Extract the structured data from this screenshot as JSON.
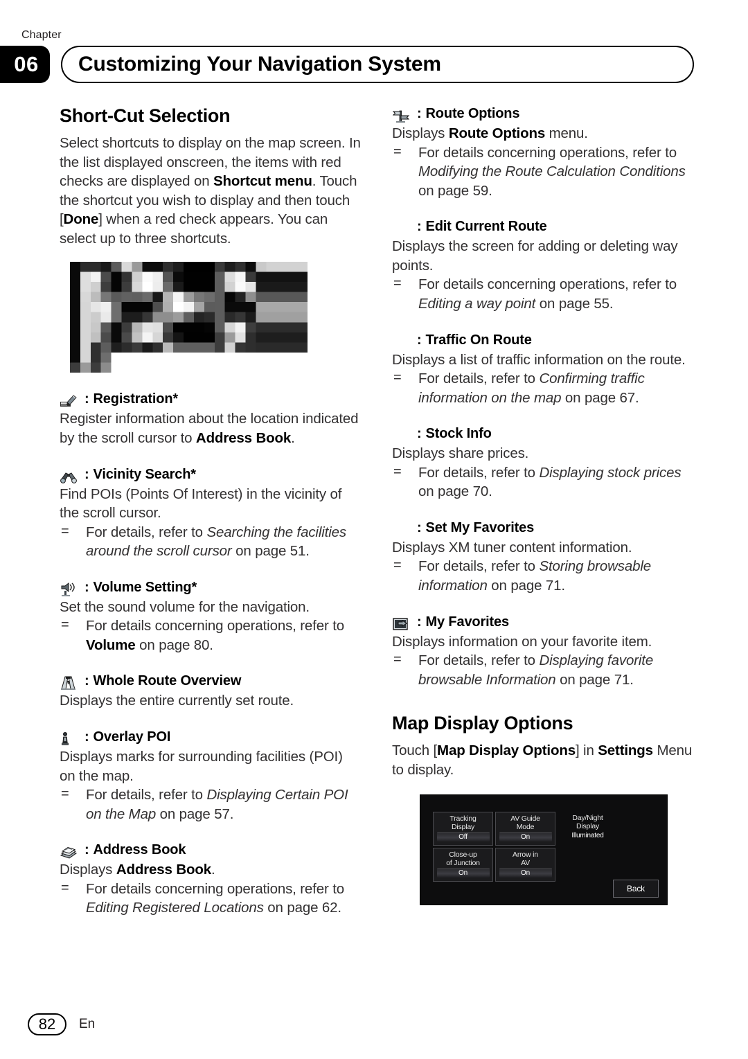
{
  "header": {
    "chapter_label": "Chapter",
    "chapter_number": "06",
    "title": "Customizing Your Navigation System"
  },
  "left_column": {
    "section_title": "Short-Cut Selection",
    "intro_runs": [
      {
        "t": "Select shortcuts to display on the map screen. In the list displayed onscreen, the items with red checks are displayed on ",
        "s": "n"
      },
      {
        "t": "Shortcut menu",
        "s": "b"
      },
      {
        "t": ". Touch the shortcut you wish to display and then touch [",
        "s": "n"
      },
      {
        "t": "Done",
        "s": "b"
      },
      {
        "t": "] when a red check appears. You can select up to three shortcuts.",
        "s": "n"
      }
    ],
    "screenshot_alt": "shortcut-selection-list-screenshot",
    "entries": [
      {
        "icon": "registration-pen-icon",
        "sep": ":",
        "title": "Registration*",
        "body_runs": [
          {
            "t": "Register information about the location indicated by the scroll cursor to ",
            "s": "n"
          },
          {
            "t": "Address Book",
            "s": "b"
          },
          {
            "t": ".",
            "s": "n"
          }
        ],
        "notes": []
      },
      {
        "icon": "binoculars-icon",
        "sep": ":",
        "title": "Vicinity Search*",
        "body_runs": [
          {
            "t": "Find POIs (Points Of Interest) in the vicinity of the scroll cursor.",
            "s": "n"
          }
        ],
        "notes": [
          {
            "mark": "=",
            "runs": [
              {
                "t": "For details, refer to ",
                "s": "n"
              },
              {
                "t": "Searching the facilities around the scroll cursor",
                "s": "i"
              },
              {
                "t": " on page 51.",
                "s": "n"
              }
            ]
          }
        ]
      },
      {
        "icon": "speaker-volume-icon",
        "sep": ":",
        "title": "Volume Setting*",
        "body_runs": [
          {
            "t": "Set the sound volume for the navigation.",
            "s": "n"
          }
        ],
        "notes": [
          {
            "mark": "=",
            "runs": [
              {
                "t": "For details concerning operations, refer to ",
                "s": "n"
              },
              {
                "t": "Volume",
                "s": "b"
              },
              {
                "t": " on page 80.",
                "s": "n"
              }
            ]
          }
        ]
      },
      {
        "icon": "whole-route-overview-icon",
        "sep": ":",
        "title": "Whole Route Overview",
        "body_runs": [
          {
            "t": "Displays the entire currently set route.",
            "s": "n"
          }
        ],
        "notes": []
      },
      {
        "icon": "overlay-poi-icon",
        "sep": ":",
        "title": "Overlay POI",
        "body_runs": [
          {
            "t": "Displays marks for surrounding facilities (POI) on the map.",
            "s": "n"
          }
        ],
        "notes": [
          {
            "mark": "=",
            "runs": [
              {
                "t": "For details, refer to ",
                "s": "n"
              },
              {
                "t": "Displaying Certain POI on the Map",
                "s": "i"
              },
              {
                "t": " on page 57.",
                "s": "n"
              }
            ]
          }
        ]
      },
      {
        "icon": "address-book-icon",
        "sep": ":",
        "title": "Address Book",
        "body_runs": [
          {
            "t": "Displays ",
            "s": "n"
          },
          {
            "t": "Address Book",
            "s": "b"
          },
          {
            "t": ".",
            "s": "n"
          }
        ],
        "notes": [
          {
            "mark": "=",
            "runs": [
              {
                "t": "For details concerning operations, refer to ",
                "s": "n"
              },
              {
                "t": "Editing Registered Locations",
                "s": "i"
              },
              {
                "t": " on page 62.",
                "s": "n"
              }
            ]
          }
        ]
      }
    ]
  },
  "right_column": {
    "entries": [
      {
        "icon": "route-options-signpost-icon",
        "sep": ":",
        "title": "Route Options",
        "body_runs": [
          {
            "t": "Displays ",
            "s": "n"
          },
          {
            "t": "Route Options",
            "s": "b"
          },
          {
            "t": " menu.",
            "s": "n"
          }
        ],
        "notes": [
          {
            "mark": "=",
            "runs": [
              {
                "t": "For details concerning operations, refer to ",
                "s": "n"
              },
              {
                "t": "Modifying the Route Calculation Conditions",
                "s": "i"
              },
              {
                "t": " on page 59.",
                "s": "n"
              }
            ]
          }
        ]
      },
      {
        "icon": "none",
        "sep": ":",
        "title": "Edit Current Route",
        "body_runs": [
          {
            "t": "Displays the screen for adding or deleting way points.",
            "s": "n"
          }
        ],
        "notes": [
          {
            "mark": "=",
            "runs": [
              {
                "t": "For details concerning operations, refer to ",
                "s": "n"
              },
              {
                "t": "Editing a way point",
                "s": "i"
              },
              {
                "t": " on page 55.",
                "s": "n"
              }
            ]
          }
        ]
      },
      {
        "icon": "none",
        "sep": ":",
        "title": "Traffic On Route",
        "body_runs": [
          {
            "t": "Displays a list of traffic information on the route.",
            "s": "n"
          }
        ],
        "notes": [
          {
            "mark": "=",
            "runs": [
              {
                "t": "For details, refer to ",
                "s": "n"
              },
              {
                "t": "Confirming traffic information on the map",
                "s": "i"
              },
              {
                "t": " on page 67.",
                "s": "n"
              }
            ]
          }
        ]
      },
      {
        "icon": "none",
        "sep": ":",
        "title": "Stock Info",
        "body_runs": [
          {
            "t": "Displays share prices.",
            "s": "n"
          }
        ],
        "notes": [
          {
            "mark": "=",
            "runs": [
              {
                "t": "For details, refer to ",
                "s": "n"
              },
              {
                "t": "Displaying stock prices",
                "s": "i"
              },
              {
                "t": " on page 70.",
                "s": "n"
              }
            ]
          }
        ]
      },
      {
        "icon": "none",
        "sep": ":",
        "title": "Set My Favorites",
        "body_runs": [
          {
            "t": "Displays XM tuner content information.",
            "s": "n"
          }
        ],
        "notes": [
          {
            "mark": "=",
            "runs": [
              {
                "t": "For details, refer to ",
                "s": "n"
              },
              {
                "t": "Storing browsable information",
                "s": "i"
              },
              {
                "t": " on page 71.",
                "s": "n"
              }
            ]
          }
        ]
      },
      {
        "icon": "my-favorites-icon",
        "sep": ":",
        "title": "My Favorites",
        "body_runs": [
          {
            "t": "Displays information on your favorite item.",
            "s": "n"
          }
        ],
        "notes": [
          {
            "mark": "=",
            "runs": [
              {
                "t": "For details, refer to ",
                "s": "n"
              },
              {
                "t": "Displaying favorite browsable Information",
                "s": "i"
              },
              {
                "t": " on page 71.",
                "s": "n"
              }
            ]
          }
        ]
      }
    ],
    "section_title": "Map Display Options",
    "section_intro_runs": [
      {
        "t": "Touch [",
        "s": "n"
      },
      {
        "t": "Map Display Options",
        "s": "b"
      },
      {
        "t": "] in ",
        "s": "n"
      },
      {
        "t": "Settings",
        "s": "b"
      },
      {
        "t": " Menu to display.",
        "s": "n"
      }
    ],
    "map_display_options_screen": {
      "buttons": [
        {
          "label_line1": "Tracking",
          "label_line2": "Display",
          "value": "Off"
        },
        {
          "label_line1": "AV Guide",
          "label_line2": "Mode",
          "value": "On"
        },
        {
          "label_line1": "Day/Night",
          "label_line2": "Display",
          "value": "Illuminated"
        },
        {
          "label_line1": "Close-up",
          "label_line2": "of Junction",
          "value": "On"
        },
        {
          "label_line1": "Arrow in",
          "label_line2": "AV",
          "value": "On"
        }
      ],
      "back_label": "Back"
    }
  },
  "footer": {
    "page_number": "82",
    "language": "En"
  }
}
